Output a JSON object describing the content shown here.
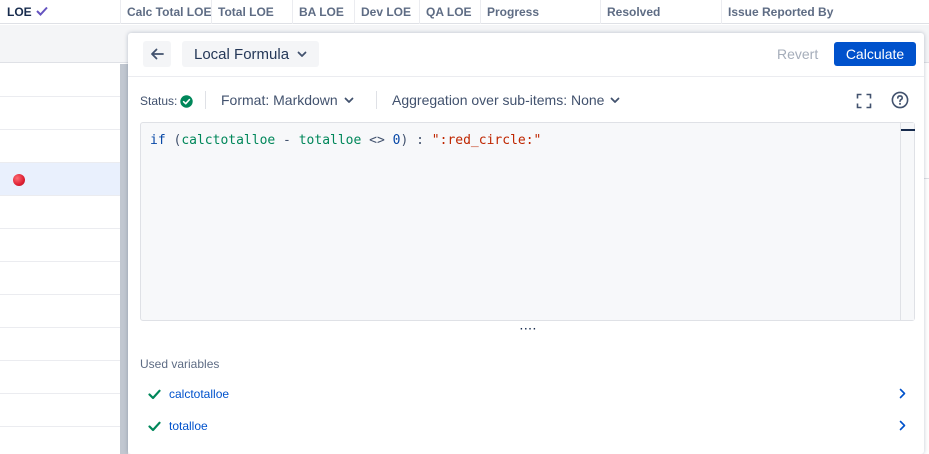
{
  "table": {
    "columns": [
      "LOE",
      "Calc Total LOE",
      "Total LOE",
      "BA LOE",
      "Dev LOE",
      "QA LOE",
      "Progress",
      "Resolved",
      "Issue Reported By"
    ]
  },
  "dialog": {
    "title": "Local Formula",
    "revert_label": "Revert",
    "calculate_label": "Calculate",
    "status_label": "Status:",
    "format_label": "Format: Markdown",
    "aggregation_label": "Aggregation over sub-items: None",
    "formula": {
      "kw_if": "if",
      "paren_open": " (",
      "var1": "calctotalloe",
      "minus": " - ",
      "var2": "totalloe",
      "cmp": " <> ",
      "zero": "0",
      "paren_close": ") : ",
      "str": "\":red_circle:\""
    },
    "used_variables_title": "Used variables",
    "used_variables": [
      "calctotalloe",
      "totalloe"
    ]
  },
  "colors": {
    "primary": "#0052cc",
    "success": "#00875a",
    "string": "#bf2600",
    "muted": "#a5adba",
    "loe_check": "#6554c0"
  }
}
